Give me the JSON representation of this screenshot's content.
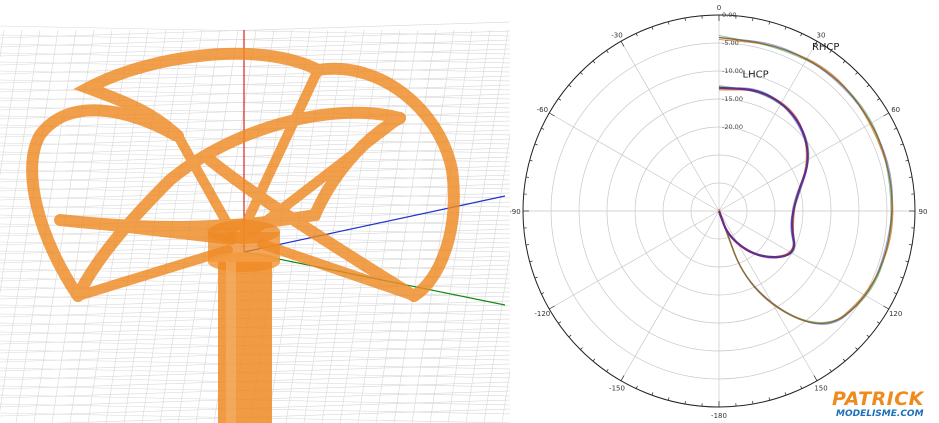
{
  "scene": {
    "description_icon": "helix-antenna-3d-model",
    "colors": {
      "antenna": "#ef8a24",
      "grid": "#d8d8d8",
      "axis_x": "#2233cc",
      "axis_y": "#118811",
      "axis_z": "#dd2222"
    }
  },
  "chart_data": {
    "type": "polar",
    "angle_labels": [
      "0",
      "30",
      "60",
      "90",
      "120",
      "150",
      "-180",
      "-150",
      "-120",
      "-90",
      "-60",
      "-30"
    ],
    "angles": [
      0,
      30,
      60,
      90,
      120,
      150,
      180,
      210,
      240,
      270,
      300,
      330
    ],
    "radial_labels": [
      "0.00",
      "-5.00",
      "-10.00",
      "-15.00",
      "-20.00"
    ],
    "radial_values": [
      0,
      -5,
      -10,
      -15,
      -20
    ],
    "rlim": [
      -35,
      0
    ],
    "grid": true,
    "series": [
      {
        "name": "RHCP",
        "color": "#8a6a3a",
        "theta": [
          0,
          20,
          40,
          60,
          80,
          100,
          120,
          140,
          160,
          180
        ],
        "r_db": [
          -4,
          -3.5,
          -3,
          -3.2,
          -3.5,
          -3.8,
          -4.2,
          -6.5,
          -20,
          -35
        ]
      },
      {
        "name": "LHCP",
        "color": "#6a2a8a",
        "theta": [
          0,
          20,
          40,
          60,
          80,
          100,
          120,
          140,
          160,
          180
        ],
        "r_db": [
          -13,
          -12,
          -13,
          -16,
          -21,
          -22,
          -19,
          -24,
          -30,
          -35
        ]
      }
    ],
    "extra_trace_colors": [
      "#d03030",
      "#3060d0",
      "#30a060",
      "#d0a030"
    ]
  },
  "logo": {
    "name": "PATRICK",
    "sub": "MODELISME.COM",
    "colors": {
      "name": "#f08a1c",
      "sub": "#1d6fb8"
    }
  }
}
